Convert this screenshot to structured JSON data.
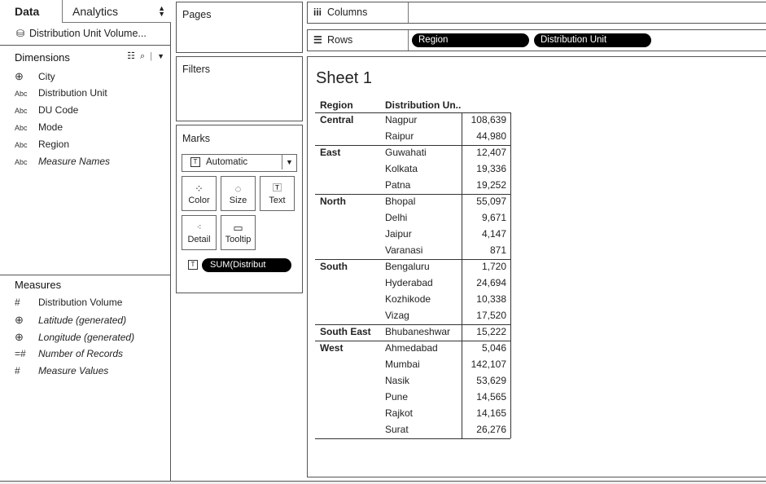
{
  "left_pane": {
    "tabs": [
      {
        "label": "Data"
      },
      {
        "label": "Analytics"
      }
    ],
    "datasource": "Distribution Unit Volume...",
    "dimensions": {
      "title": "Dimensions",
      "items": [
        {
          "label": "City",
          "icon": "globe-icon"
        },
        {
          "label": "Distribution Unit",
          "icon": "abc-icon"
        },
        {
          "label": "DU Code",
          "icon": "abc-icon"
        },
        {
          "label": "Mode",
          "icon": "abc-icon"
        },
        {
          "label": "Region",
          "icon": "abc-icon"
        },
        {
          "label": "Measure Names",
          "icon": "abc-icon"
        }
      ]
    },
    "measures": {
      "title": "Measures",
      "items": [
        {
          "label": "Distribution Volume",
          "icon": "hash-icon"
        },
        {
          "label": "Latitude (generated)",
          "icon": "globe-icon"
        },
        {
          "label": "Longitude (generated)",
          "icon": "globe-icon"
        },
        {
          "label": "Number of Records",
          "icon": "hash-eq-icon"
        },
        {
          "label": "Measure Values",
          "icon": "hash-icon"
        }
      ]
    }
  },
  "cards": {
    "pages": "Pages",
    "filters": "Filters",
    "marks": {
      "title": "Marks",
      "type": "Automatic",
      "buttons": [
        {
          "label": "Color"
        },
        {
          "label": "Size"
        },
        {
          "label": "Text"
        },
        {
          "label": "Detail"
        },
        {
          "label": "Tooltip"
        }
      ],
      "pill": "SUM(Distribut"
    }
  },
  "shelves": {
    "columns_label": "Columns",
    "rows_label": "Rows",
    "row_pills": [
      "Region",
      "Distribution Unit"
    ]
  },
  "sheet": {
    "title": "Sheet 1",
    "headers": [
      "Region",
      "Distribution Un.."
    ],
    "rows": [
      {
        "region": "Central",
        "unit": "Nagpur",
        "value": "108,639"
      },
      {
        "region": "",
        "unit": "Raipur",
        "value": "44,980"
      },
      {
        "region": "East",
        "unit": "Guwahati",
        "value": "12,407"
      },
      {
        "region": "",
        "unit": "Kolkata",
        "value": "19,336"
      },
      {
        "region": "",
        "unit": "Patna",
        "value": "19,252"
      },
      {
        "region": "North",
        "unit": "Bhopal",
        "value": "55,097"
      },
      {
        "region": "",
        "unit": "Delhi",
        "value": "9,671"
      },
      {
        "region": "",
        "unit": "Jaipur",
        "value": "4,147"
      },
      {
        "region": "",
        "unit": "Varanasi",
        "value": "871"
      },
      {
        "region": "South",
        "unit": "Bengaluru",
        "value": "1,720"
      },
      {
        "region": "",
        "unit": "Hyderabad",
        "value": "24,694"
      },
      {
        "region": "",
        "unit": "Kozhikode",
        "value": "10,338"
      },
      {
        "region": "",
        "unit": "Vizag",
        "value": "17,520"
      },
      {
        "region": "South East",
        "unit": "Bhubaneshwar",
        "value": "15,222"
      },
      {
        "region": "West",
        "unit": "Ahmedabad",
        "value": "5,046"
      },
      {
        "region": "",
        "unit": "Mumbai",
        "value": "142,107"
      },
      {
        "region": "",
        "unit": "Nasik",
        "value": "53,629"
      },
      {
        "region": "",
        "unit": "Pune",
        "value": "14,565"
      },
      {
        "region": "",
        "unit": "Rajkot",
        "value": "14,165"
      },
      {
        "region": "",
        "unit": "Surat",
        "value": "26,276"
      }
    ]
  }
}
